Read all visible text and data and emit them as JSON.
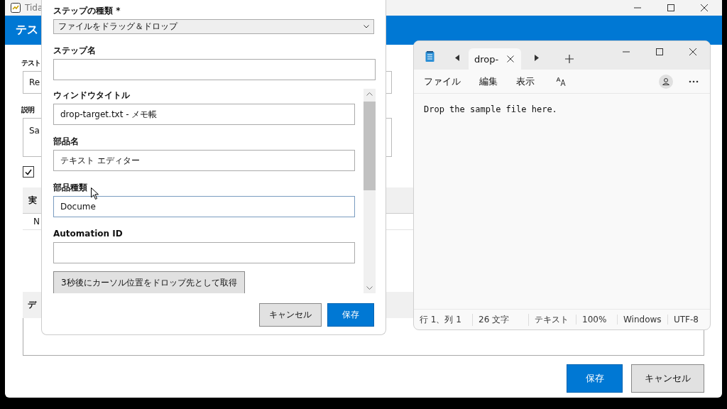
{
  "background_window": {
    "title": "Tida",
    "header": "テス",
    "fields": [
      {
        "label": "テスト",
        "value": "Re",
        "kind": "input"
      },
      {
        "label": "説明",
        "value": "Sa",
        "kind": "textarea"
      }
    ],
    "checkbox": {
      "checked": true
    },
    "table": {
      "header": "実",
      "rows": [
        {
          "cell": "N"
        }
      ]
    },
    "section": {
      "title": "デ"
    },
    "buttons": [
      {
        "label": "保存",
        "kind": "primary"
      },
      {
        "label": "キャンセル",
        "kind": "secondary"
      }
    ]
  },
  "dialog": {
    "step_type": {
      "label": "ステップの種類 *",
      "value": "ファイルをドラッグ＆ドロップ"
    },
    "step_name": {
      "label": "ステップ名"
    },
    "fields": [
      {
        "label": "ウィンドウタイトル",
        "value": "drop-target.txt - メモ帳",
        "focused": false
      },
      {
        "label": "部品名",
        "value": "テキスト エディター",
        "focused": false
      },
      {
        "label": "部品種類",
        "value": "Docume",
        "focused": true
      },
      {
        "label": "Automation ID",
        "focused": false
      }
    ],
    "capture_button": "3秒後にカーソル位置をドロップ先として取得",
    "buttons": [
      {
        "label": "キャンセル",
        "kind": "secondary"
      },
      {
        "label": "保存",
        "kind": "primary"
      }
    ]
  },
  "notepad": {
    "tab": {
      "title": "drop-",
      "selected": true
    },
    "menu": [
      "ファイル",
      "編集",
      "表示"
    ],
    "content": "Drop the sample file here.",
    "status_bar": [
      "行 1、列 1",
      "26 文字",
      "テキスト",
      "100%",
      "Windows",
      "UTF-8"
    ]
  }
}
